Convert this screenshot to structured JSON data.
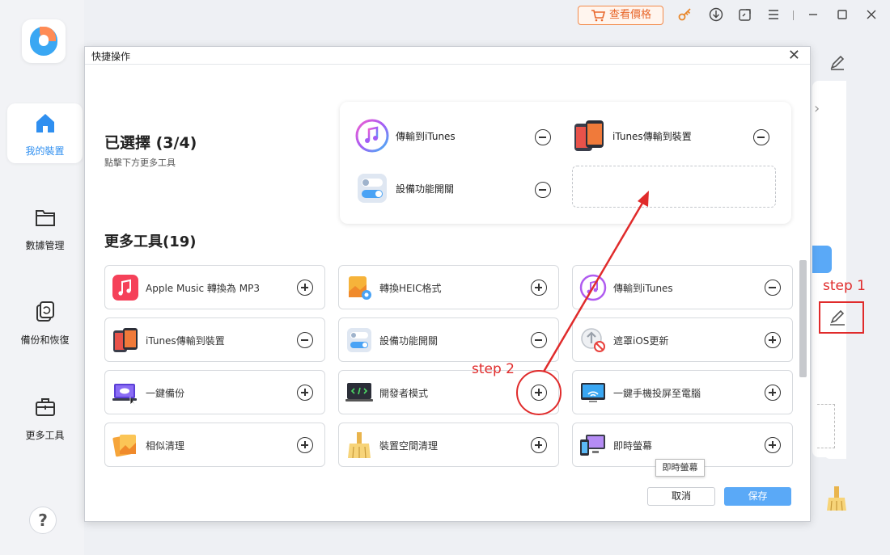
{
  "sidebar": {
    "items": [
      {
        "label": "我的裝置",
        "icon": "home-icon",
        "active": true
      },
      {
        "label": "數據管理",
        "icon": "folder-icon",
        "active": false
      },
      {
        "label": "備份和恢復",
        "icon": "backup-restore-icon",
        "active": false
      },
      {
        "label": "更多工具",
        "icon": "toolbox-icon",
        "active": false
      }
    ],
    "help": "?"
  },
  "titlebar": {
    "price_label": "查看價格",
    "icons": [
      "key-icon",
      "download-icon",
      "feedback-icon",
      "menu-icon",
      "minimize-icon",
      "maximize-icon",
      "close-icon"
    ]
  },
  "dialog": {
    "title": "快捷操作",
    "selected_heading": "已選擇 (3/4)",
    "selected_hint": "點擊下方更多工具",
    "more_heading": "更多工具(19)",
    "selected": [
      {
        "name": "傳輸到iTunes",
        "icon": "itunes-icon"
      },
      {
        "name": "iTunes傳輸到裝置",
        "icon": "phone-transfer-icon"
      },
      {
        "name": "設備功能開關",
        "icon": "toggle-switch-icon"
      }
    ],
    "tools": [
      {
        "name": "Apple Music 轉換為 MP3",
        "icon": "apple-music-icon",
        "action": "add"
      },
      {
        "name": "轉換HEIC格式",
        "icon": "heic-convert-icon",
        "action": "add"
      },
      {
        "name": "傳輸到iTunes",
        "icon": "itunes-icon",
        "action": "remove"
      },
      {
        "name": "iTunes傳輸到裝置",
        "icon": "phone-transfer-icon",
        "action": "remove"
      },
      {
        "name": "設備功能開關",
        "icon": "toggle-switch-icon",
        "action": "remove"
      },
      {
        "name": "遮罩iOS更新",
        "icon": "block-ios-update-icon",
        "action": "add"
      },
      {
        "name": "一鍵備份",
        "icon": "one-click-backup-icon",
        "action": "add"
      },
      {
        "name": "開發者模式",
        "icon": "developer-mode-icon",
        "action": "add"
      },
      {
        "name": "一鍵手機投屏至電腦",
        "icon": "screen-mirror-icon",
        "action": "add"
      },
      {
        "name": "相似清理",
        "icon": "similar-photos-icon",
        "action": "add"
      },
      {
        "name": "裝置空間清理",
        "icon": "broom-icon",
        "action": "add"
      },
      {
        "name": "即時螢幕",
        "icon": "live-screen-icon",
        "action": "add"
      }
    ],
    "tooltip": "即時螢幕",
    "cancel_label": "取消",
    "save_label": "保存"
  },
  "annotations": {
    "step1": "step 1",
    "step2": "step 2",
    "color": "#e02b2b"
  },
  "colors": {
    "accent": "#5aa9f7",
    "price_orange": "#e8672b",
    "active_nav": "#2f8ff0"
  }
}
